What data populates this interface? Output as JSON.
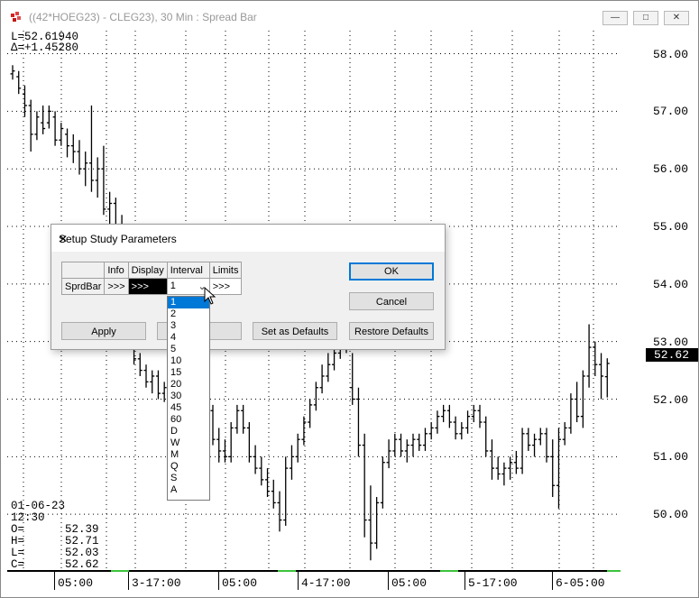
{
  "window": {
    "title": "((42*HOEG23) - CLEG23), 30 Min : Spread Bar",
    "controls": {
      "minimize": "—",
      "maximize": "□",
      "close": "✕"
    }
  },
  "chart_overlay": {
    "last_label": "L=52.61940",
    "delta_label": "Δ=+1.45280",
    "current_price_tag": "52.62"
  },
  "readout": {
    "date": "01-06-23",
    "time": "12:30",
    "open": "O=      52.39",
    "high": "H=      52.71",
    "low": "L=      52.03",
    "close": "C=      52.62"
  },
  "chart_data": {
    "type": "bar",
    "title": "((42*HOEG23) - CLEG23), 30 Min : Spread Bar",
    "y_ticks": [
      "58.00",
      "57.00",
      "56.00",
      "55.00",
      "54.00",
      "53.00",
      "52.00",
      "51.00",
      "50.00"
    ],
    "x_ticks": [
      "05:00",
      "3-17:00",
      "05:00",
      "4-17:00",
      "05:00",
      "5-17:00",
      "6-05:00"
    ],
    "ylim": [
      49.0,
      58.4
    ],
    "grid": true,
    "series": [
      {
        "values": [
          [
            57.65,
            57.8,
            57.55,
            57.7
          ],
          [
            57.6,
            57.7,
            57.3,
            57.4
          ],
          [
            57.3,
            57.45,
            56.9,
            57.1
          ],
          [
            57.1,
            57.2,
            56.3,
            56.6
          ],
          [
            56.6,
            57.0,
            56.5,
            56.9
          ],
          [
            56.8,
            57.1,
            56.6,
            56.7
          ],
          [
            56.8,
            57.1,
            56.7,
            57.0
          ],
          [
            56.9,
            57.0,
            56.4,
            56.5
          ],
          [
            56.5,
            56.8,
            56.4,
            56.7
          ],
          [
            56.6,
            56.7,
            56.2,
            56.4
          ],
          [
            56.4,
            56.6,
            56.1,
            56.3
          ],
          [
            56.3,
            56.5,
            55.9,
            56.0
          ],
          [
            56.0,
            56.3,
            55.7,
            56.1
          ],
          [
            56.1,
            57.1,
            55.6,
            55.8
          ],
          [
            55.8,
            56.2,
            55.5,
            56.0
          ],
          [
            56.0,
            56.4,
            55.2,
            55.3
          ],
          [
            55.3,
            55.6,
            55.0,
            55.4
          ],
          [
            55.4,
            55.5,
            54.9,
            55.0
          ],
          [
            55.0,
            55.2,
            54.5,
            54.7
          ],
          [
            54.7,
            55.0,
            54.3,
            54.4
          ],
          [
            52.9,
            53.1,
            52.6,
            52.7
          ],
          [
            52.7,
            52.8,
            52.4,
            52.5
          ],
          [
            52.5,
            52.6,
            52.2,
            52.3
          ],
          [
            52.3,
            52.5,
            52.1,
            52.4
          ],
          [
            52.4,
            52.5,
            52.0,
            52.1
          ],
          [
            52.1,
            52.3,
            51.95,
            52.2
          ],
          [
            52.2,
            52.5,
            52.1,
            52.4
          ],
          [
            52.3,
            52.5,
            52.2,
            52.4
          ],
          [
            52.4,
            52.6,
            52.3,
            52.5
          ],
          [
            52.5,
            52.7,
            52.4,
            52.6
          ],
          [
            52.6,
            52.8,
            52.5,
            52.7
          ],
          [
            52.7,
            52.9,
            52.6,
            52.8
          ],
          [
            52.0,
            52.2,
            51.6,
            51.8
          ],
          [
            51.8,
            51.9,
            51.2,
            51.3
          ],
          [
            51.3,
            51.5,
            50.9,
            51.1
          ],
          [
            51.1,
            51.3,
            50.9,
            51.0
          ],
          [
            51.0,
            51.6,
            50.9,
            51.5
          ],
          [
            51.5,
            51.9,
            51.4,
            51.8
          ],
          [
            51.8,
            51.9,
            51.4,
            51.5
          ],
          [
            51.5,
            51.6,
            50.9,
            51.0
          ],
          [
            51.0,
            51.2,
            50.7,
            50.8
          ],
          [
            50.8,
            51.0,
            50.5,
            50.6
          ],
          [
            50.6,
            50.8,
            50.3,
            50.4
          ],
          [
            50.4,
            50.6,
            50.1,
            50.2
          ],
          [
            50.2,
            50.4,
            49.7,
            49.9
          ],
          [
            49.9,
            51.0,
            49.8,
            50.8
          ],
          [
            50.8,
            51.2,
            50.6,
            51.0
          ],
          [
            51.0,
            51.4,
            50.9,
            51.3
          ],
          [
            51.3,
            51.7,
            51.2,
            51.6
          ],
          [
            51.6,
            52.0,
            51.5,
            51.9
          ],
          [
            51.9,
            52.3,
            51.8,
            52.2
          ],
          [
            52.2,
            52.6,
            52.1,
            52.4
          ],
          [
            52.4,
            52.8,
            52.3,
            52.6
          ],
          [
            52.6,
            53.0,
            52.5,
            52.8
          ],
          [
            52.8,
            53.1,
            52.7,
            53.0
          ],
          [
            53.0,
            53.2,
            52.8,
            52.9
          ],
          [
            52.2,
            52.8,
            51.9,
            52.0
          ],
          [
            52.0,
            52.2,
            51.0,
            51.2
          ],
          [
            51.2,
            51.4,
            49.6,
            49.9
          ],
          [
            49.9,
            50.5,
            49.2,
            49.5
          ],
          [
            49.5,
            50.3,
            49.4,
            50.2
          ],
          [
            50.2,
            51.0,
            50.1,
            50.9
          ],
          [
            50.9,
            51.3,
            50.8,
            51.1
          ],
          [
            51.1,
            51.4,
            51.0,
            51.3
          ],
          [
            51.3,
            51.4,
            51.0,
            51.1
          ],
          [
            51.1,
            51.3,
            50.9,
            51.2
          ],
          [
            51.2,
            51.4,
            51.0,
            51.3
          ],
          [
            51.3,
            51.4,
            51.1,
            51.2
          ],
          [
            51.2,
            51.5,
            51.1,
            51.4
          ],
          [
            51.4,
            51.6,
            51.3,
            51.5
          ],
          [
            51.5,
            51.8,
            51.4,
            51.7
          ],
          [
            51.7,
            51.9,
            51.6,
            51.8
          ],
          [
            51.8,
            51.9,
            51.5,
            51.6
          ],
          [
            51.6,
            51.7,
            51.3,
            51.4
          ],
          [
            51.4,
            51.6,
            51.3,
            51.5
          ],
          [
            51.5,
            51.8,
            51.4,
            51.7
          ],
          [
            51.7,
            51.9,
            51.6,
            51.8
          ],
          [
            51.8,
            51.9,
            51.5,
            51.6
          ],
          [
            51.6,
            51.7,
            51.0,
            51.1
          ],
          [
            51.1,
            51.3,
            50.6,
            50.8
          ],
          [
            50.8,
            51.0,
            50.6,
            50.7
          ],
          [
            50.7,
            50.9,
            50.5,
            50.8
          ],
          [
            50.8,
            51.0,
            50.6,
            50.9
          ],
          [
            50.9,
            51.1,
            50.7,
            50.8
          ],
          [
            50.8,
            51.5,
            50.7,
            51.4
          ],
          [
            51.4,
            51.5,
            51.1,
            51.2
          ],
          [
            51.2,
            51.4,
            51.0,
            51.3
          ],
          [
            51.3,
            51.5,
            51.2,
            51.4
          ],
          [
            51.4,
            51.5,
            50.9,
            51.0
          ],
          [
            51.0,
            51.3,
            50.3,
            50.5
          ],
          [
            50.5,
            51.5,
            50.1,
            51.3
          ],
          [
            51.3,
            51.6,
            51.2,
            51.5
          ],
          [
            51.5,
            52.1,
            51.4,
            52.0
          ],
          [
            52.0,
            52.3,
            51.6,
            51.7
          ],
          [
            51.7,
            52.5,
            51.5,
            52.4
          ],
          [
            52.4,
            53.3,
            52.2,
            52.9
          ],
          [
            52.9,
            53.0,
            52.4,
            52.6
          ],
          [
            52.6,
            52.8,
            52.0,
            52.4
          ],
          [
            52.39,
            52.71,
            52.03,
            52.62
          ]
        ]
      }
    ]
  },
  "dialog": {
    "title": "Setup Study Parameters",
    "columns": [
      "",
      "Info",
      "Display",
      "Interval",
      "Limits"
    ],
    "row": {
      "name": "SprdBar",
      "info": ">>>",
      "display": ">>>",
      "interval": "1",
      "limits": ">>>"
    },
    "buttons": {
      "ok": "OK",
      "cancel": "Cancel",
      "apply": "Apply",
      "set_defaults": "Set as Defaults",
      "restore_defaults": "Restore Defaults"
    },
    "interval_options": [
      "1",
      "2",
      "3",
      "4",
      "5",
      "10",
      "15",
      "20",
      "30",
      "45",
      "60",
      "D",
      "W",
      "M",
      "Q",
      "S",
      "A"
    ],
    "selected_option": "1"
  }
}
